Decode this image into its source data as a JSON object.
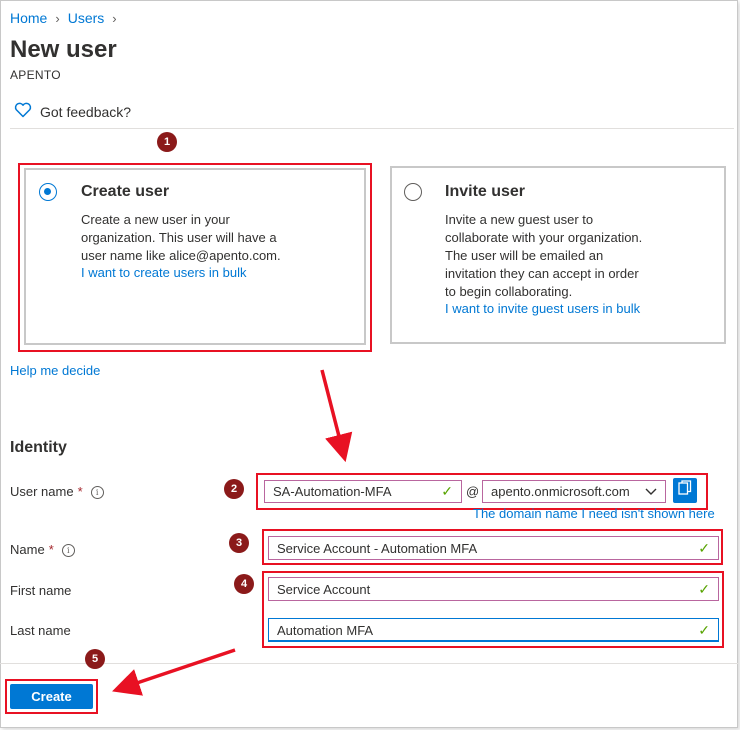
{
  "breadcrumb": {
    "home": "Home",
    "users": "Users",
    "separator": "›"
  },
  "page": {
    "title": "New user",
    "tenant": "APENTO"
  },
  "feedback": {
    "label": "Got feedback?"
  },
  "badges": {
    "b1": "1",
    "b2": "2",
    "b3": "3",
    "b4": "4",
    "b5": "5"
  },
  "options": {
    "create": {
      "title": "Create user",
      "line1": "Create a new user in your",
      "line2": "organization. This user will have a",
      "line3": "user name like alice@apento.com.",
      "link": "I want to create users in bulk"
    },
    "invite": {
      "title": "Invite user",
      "line1": "Invite a new guest user to",
      "line2": "collaborate with your organization.",
      "line3": "The user will be emailed an",
      "line4": "invitation they can accept in order",
      "line5": "to begin collaborating.",
      "link": "I want to invite guest users in bulk"
    }
  },
  "help_link": "Help me decide",
  "identity": {
    "heading": "Identity",
    "username_label": "User name",
    "username_value": "SA-Automation-MFA",
    "at_sign": "@",
    "domain_value": "apento.onmicrosoft.com",
    "domain_hint": "The domain name I need isn't shown here",
    "name_label": "Name",
    "name_value": "Service Account - Automation MFA",
    "first_label": "First name",
    "first_value": "Service Account",
    "last_label": "Last name",
    "last_value": "Automation MFA",
    "required_mark": "*",
    "info_glyph": "i",
    "check_glyph": "✓"
  },
  "actions": {
    "create_label": "Create"
  },
  "colors": {
    "accent": "#0078d4",
    "annotation_red": "#e81123",
    "badge": "#8b1a1a",
    "valid": "#57a300"
  },
  "icons": [
    "heart-icon",
    "chevron-right-icon",
    "info-icon",
    "checkmark-icon",
    "chevron-down-icon",
    "copy-icon",
    "arrow-annotation"
  ]
}
